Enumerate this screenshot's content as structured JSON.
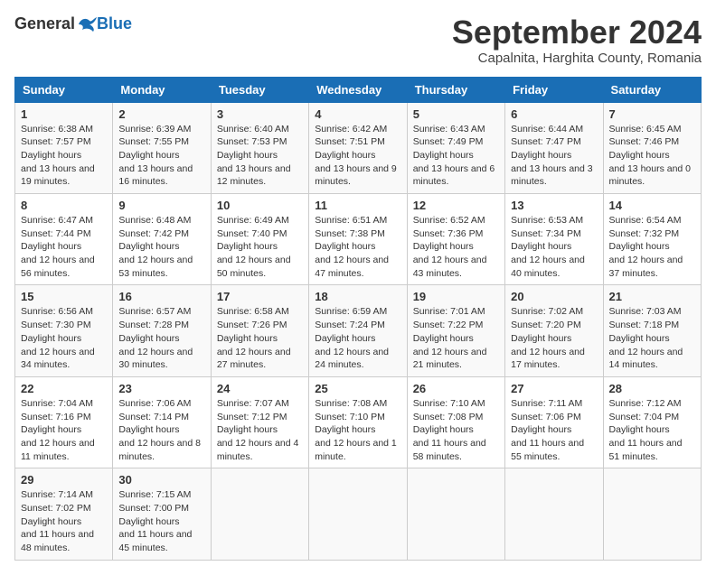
{
  "header": {
    "logo_general": "General",
    "logo_blue": "Blue",
    "month_title": "September 2024",
    "subtitle": "Capalnita, Harghita County, Romania"
  },
  "weekdays": [
    "Sunday",
    "Monday",
    "Tuesday",
    "Wednesday",
    "Thursday",
    "Friday",
    "Saturday"
  ],
  "weeks": [
    [
      {
        "day": "1",
        "sunrise": "6:38 AM",
        "sunset": "7:57 PM",
        "daylight": "13 hours and 19 minutes."
      },
      {
        "day": "2",
        "sunrise": "6:39 AM",
        "sunset": "7:55 PM",
        "daylight": "13 hours and 16 minutes."
      },
      {
        "day": "3",
        "sunrise": "6:40 AM",
        "sunset": "7:53 PM",
        "daylight": "13 hours and 12 minutes."
      },
      {
        "day": "4",
        "sunrise": "6:42 AM",
        "sunset": "7:51 PM",
        "daylight": "13 hours and 9 minutes."
      },
      {
        "day": "5",
        "sunrise": "6:43 AM",
        "sunset": "7:49 PM",
        "daylight": "13 hours and 6 minutes."
      },
      {
        "day": "6",
        "sunrise": "6:44 AM",
        "sunset": "7:47 PM",
        "daylight": "13 hours and 3 minutes."
      },
      {
        "day": "7",
        "sunrise": "6:45 AM",
        "sunset": "7:46 PM",
        "daylight": "13 hours and 0 minutes."
      }
    ],
    [
      {
        "day": "8",
        "sunrise": "6:47 AM",
        "sunset": "7:44 PM",
        "daylight": "12 hours and 56 minutes."
      },
      {
        "day": "9",
        "sunrise": "6:48 AM",
        "sunset": "7:42 PM",
        "daylight": "12 hours and 53 minutes."
      },
      {
        "day": "10",
        "sunrise": "6:49 AM",
        "sunset": "7:40 PM",
        "daylight": "12 hours and 50 minutes."
      },
      {
        "day": "11",
        "sunrise": "6:51 AM",
        "sunset": "7:38 PM",
        "daylight": "12 hours and 47 minutes."
      },
      {
        "day": "12",
        "sunrise": "6:52 AM",
        "sunset": "7:36 PM",
        "daylight": "12 hours and 43 minutes."
      },
      {
        "day": "13",
        "sunrise": "6:53 AM",
        "sunset": "7:34 PM",
        "daylight": "12 hours and 40 minutes."
      },
      {
        "day": "14",
        "sunrise": "6:54 AM",
        "sunset": "7:32 PM",
        "daylight": "12 hours and 37 minutes."
      }
    ],
    [
      {
        "day": "15",
        "sunrise": "6:56 AM",
        "sunset": "7:30 PM",
        "daylight": "12 hours and 34 minutes."
      },
      {
        "day": "16",
        "sunrise": "6:57 AM",
        "sunset": "7:28 PM",
        "daylight": "12 hours and 30 minutes."
      },
      {
        "day": "17",
        "sunrise": "6:58 AM",
        "sunset": "7:26 PM",
        "daylight": "12 hours and 27 minutes."
      },
      {
        "day": "18",
        "sunrise": "6:59 AM",
        "sunset": "7:24 PM",
        "daylight": "12 hours and 24 minutes."
      },
      {
        "day": "19",
        "sunrise": "7:01 AM",
        "sunset": "7:22 PM",
        "daylight": "12 hours and 21 minutes."
      },
      {
        "day": "20",
        "sunrise": "7:02 AM",
        "sunset": "7:20 PM",
        "daylight": "12 hours and 17 minutes."
      },
      {
        "day": "21",
        "sunrise": "7:03 AM",
        "sunset": "7:18 PM",
        "daylight": "12 hours and 14 minutes."
      }
    ],
    [
      {
        "day": "22",
        "sunrise": "7:04 AM",
        "sunset": "7:16 PM",
        "daylight": "12 hours and 11 minutes."
      },
      {
        "day": "23",
        "sunrise": "7:06 AM",
        "sunset": "7:14 PM",
        "daylight": "12 hours and 8 minutes."
      },
      {
        "day": "24",
        "sunrise": "7:07 AM",
        "sunset": "7:12 PM",
        "daylight": "12 hours and 4 minutes."
      },
      {
        "day": "25",
        "sunrise": "7:08 AM",
        "sunset": "7:10 PM",
        "daylight": "12 hours and 1 minute."
      },
      {
        "day": "26",
        "sunrise": "7:10 AM",
        "sunset": "7:08 PM",
        "daylight": "11 hours and 58 minutes."
      },
      {
        "day": "27",
        "sunrise": "7:11 AM",
        "sunset": "7:06 PM",
        "daylight": "11 hours and 55 minutes."
      },
      {
        "day": "28",
        "sunrise": "7:12 AM",
        "sunset": "7:04 PM",
        "daylight": "11 hours and 51 minutes."
      }
    ],
    [
      {
        "day": "29",
        "sunrise": "7:14 AM",
        "sunset": "7:02 PM",
        "daylight": "11 hours and 48 minutes."
      },
      {
        "day": "30",
        "sunrise": "7:15 AM",
        "sunset": "7:00 PM",
        "daylight": "11 hours and 45 minutes."
      },
      null,
      null,
      null,
      null,
      null
    ]
  ],
  "labels": {
    "sunrise": "Sunrise:",
    "sunset": "Sunset:",
    "daylight": "Daylight hours"
  }
}
